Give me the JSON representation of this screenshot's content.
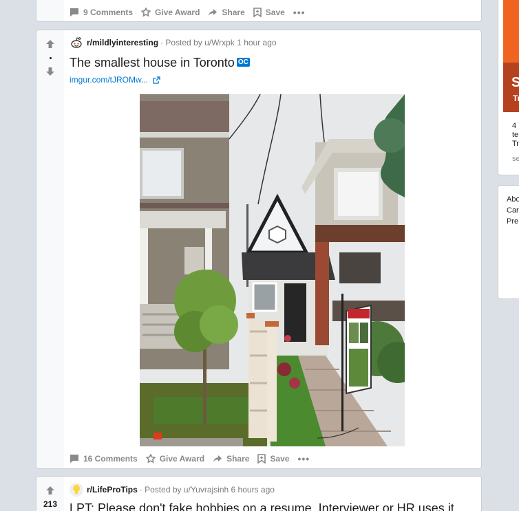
{
  "prev_post": {
    "actions": {
      "comments": "9 Comments",
      "award": "Give Award",
      "share": "Share",
      "save": "Save",
      "more": "•••"
    }
  },
  "main_post": {
    "subreddit": "r/mildlyinteresting",
    "posted_by": "· Posted by u/Wrxpk 1 hour ago",
    "title": "The smallest house in Toronto",
    "flair": "OC",
    "link": "imgur.com/tJROMw...",
    "actions": {
      "comments": "16 Comments",
      "award": "Give Award",
      "share": "Share",
      "save": "Save",
      "more": "•••"
    }
  },
  "next_post": {
    "subreddit": "r/LifeProTips",
    "posted_by": "· Posted by u/Yuvrajsinh 6 hours ago",
    "vote_count": "213",
    "title": "LPT: Please don't fake hobbies on a resume. Interviewer or HR uses it"
  },
  "sidebar": {
    "banner_big": "S",
    "banner_small": "Tr",
    "card_lines": [
      "4",
      "te",
      "Tr"
    ],
    "card_muted": "se",
    "links": [
      "Abo",
      "Car",
      "Pre"
    ]
  },
  "colors": {
    "accent": "#0079d3",
    "background": "#dae0e6",
    "muted": "#878a8c",
    "banner": "#f06422"
  }
}
